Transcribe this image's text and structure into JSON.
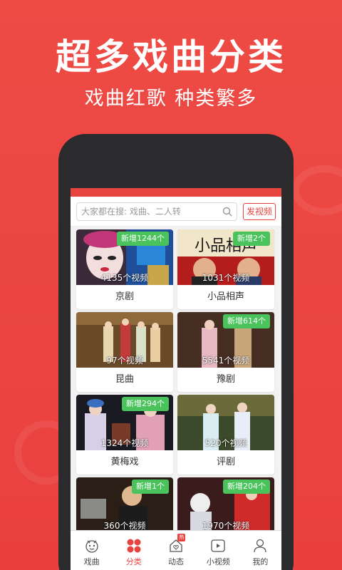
{
  "promo": {
    "headline": "超多戏曲分类",
    "subline": "戏曲红歌 种类繁多"
  },
  "search": {
    "placeholder": "大家都在搜: 戏曲、二人转",
    "post_label": "发视频"
  },
  "categories": [
    {
      "badge": "新增1244个",
      "count": "4135个视频",
      "name": "京剧"
    },
    {
      "badge": "新增2个",
      "count": "1031个视频",
      "name": "小品相声"
    },
    {
      "badge": "",
      "count": "97个视频",
      "name": "昆曲"
    },
    {
      "badge": "新增614个",
      "count": "5541个视频",
      "name": "豫剧"
    },
    {
      "badge": "新增294个",
      "count": "1324个视频",
      "name": "黄梅戏"
    },
    {
      "badge": "",
      "count": "520个视频",
      "name": "评剧"
    },
    {
      "badge": "新增1个",
      "count": "360个视频",
      "name": ""
    },
    {
      "badge": "新增204个",
      "count": "1970个视频",
      "name": ""
    }
  ],
  "thumb_text": {
    "xiaopin": "小品相声"
  },
  "tabbar": {
    "tabs": [
      {
        "label": "戏曲",
        "icon": "opera-face-icon"
      },
      {
        "label": "分类",
        "icon": "category-grid-icon",
        "active": true
      },
      {
        "label": "动态",
        "icon": "heart-home-icon",
        "badge": "热"
      },
      {
        "label": "小视频",
        "icon": "play-icon"
      },
      {
        "label": "我的",
        "icon": "user-icon"
      }
    ]
  },
  "colors": {
    "brand": "#e8443f",
    "badge": "#4bc35d"
  }
}
